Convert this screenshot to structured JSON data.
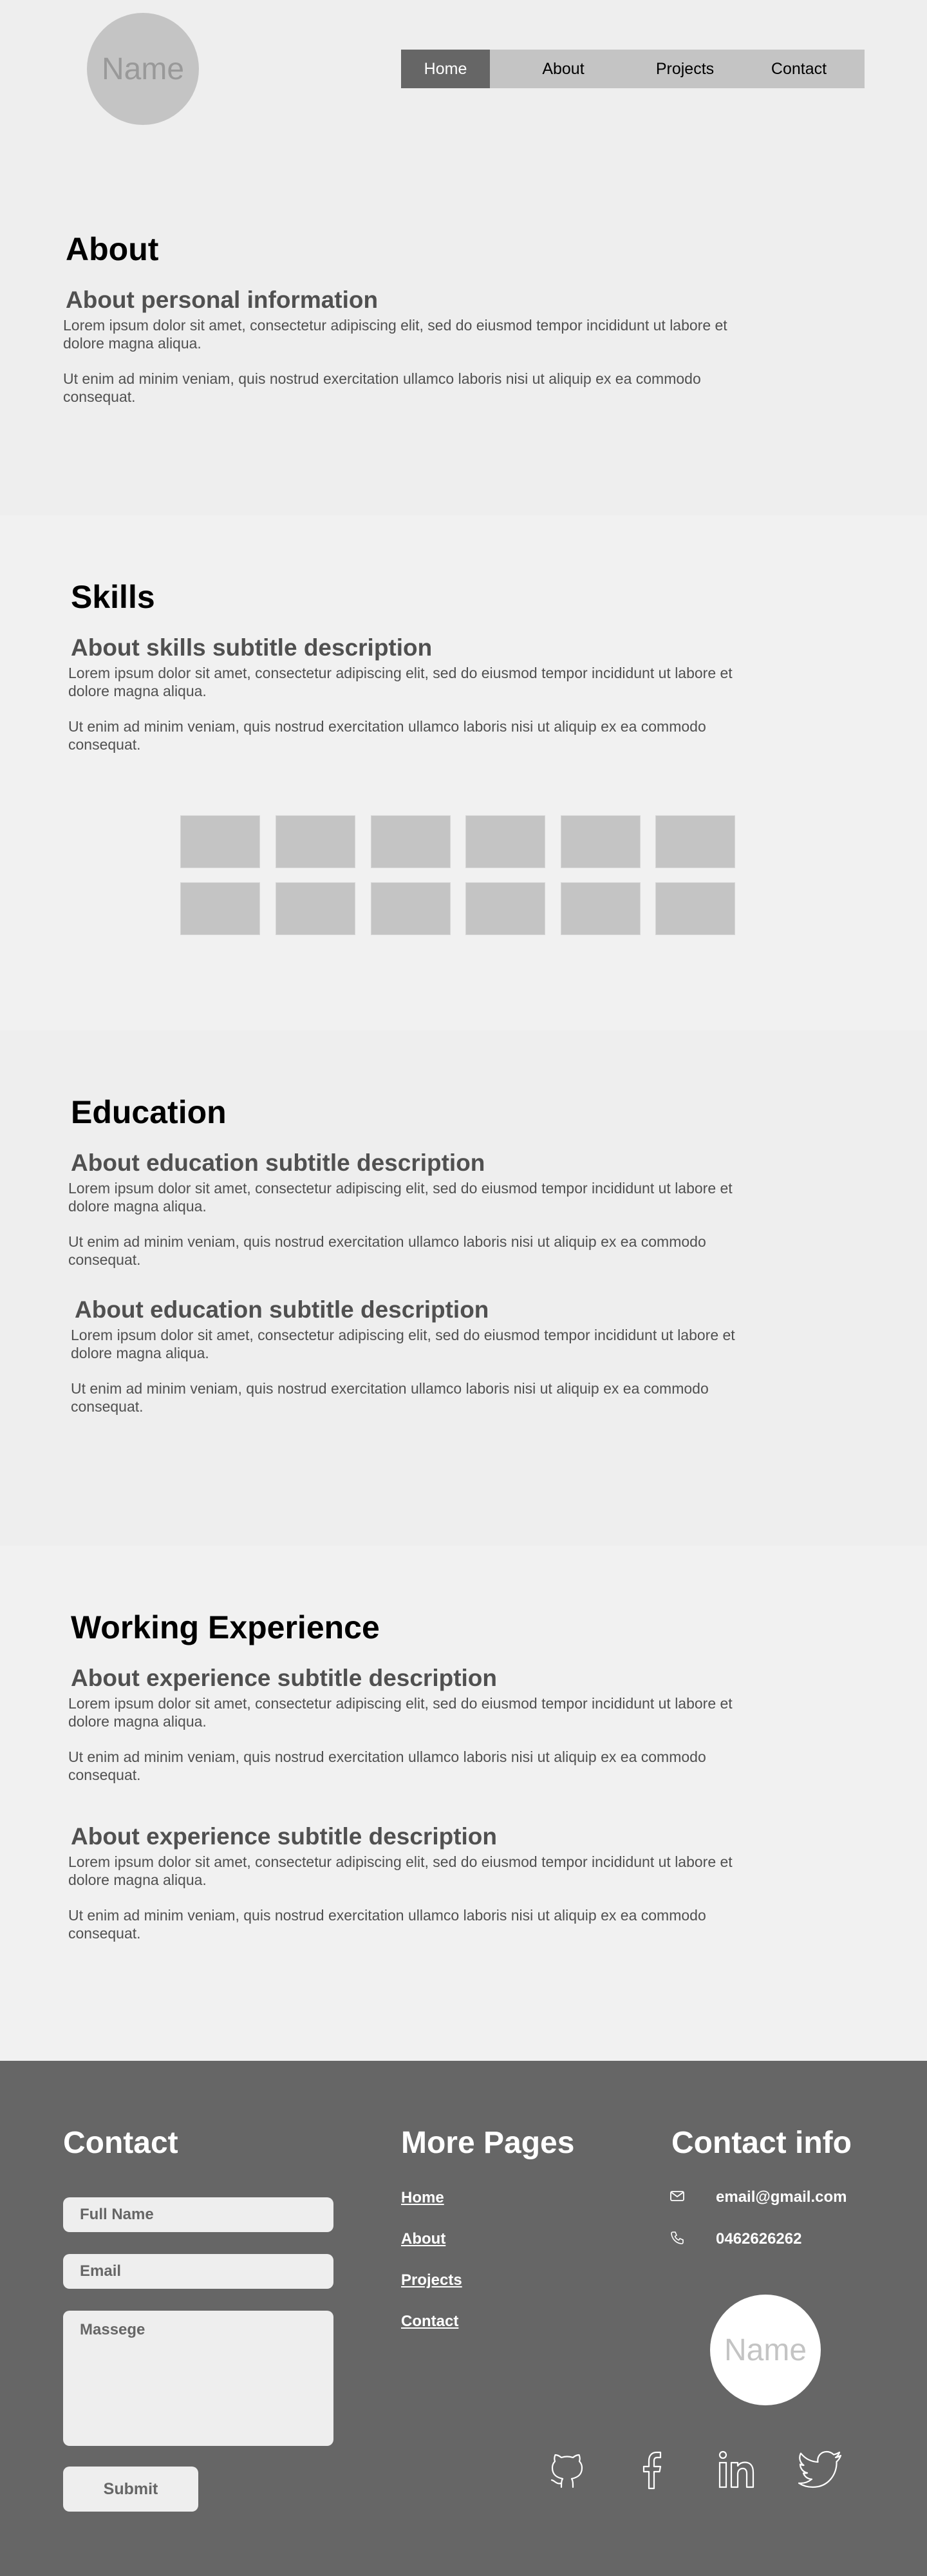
{
  "header": {
    "logo_text": "Name",
    "nav": [
      {
        "label": "Home",
        "active": true
      },
      {
        "label": "About",
        "active": false
      },
      {
        "label": "Projects",
        "active": false
      },
      {
        "label": "Contact",
        "active": false
      }
    ]
  },
  "about": {
    "title": "About",
    "subtitle": "About personal information",
    "paragraphs": [
      "Lorem ipsum dolor sit amet, consectetur adipiscing elit, sed do eiusmod tempor incididunt ut labore et dolore magna aliqua.",
      "Ut enim ad minim veniam, quis nostrud exercitation ullamco laboris nisi ut aliquip ex ea commodo consequat."
    ]
  },
  "skills": {
    "title": "Skills",
    "subtitle": "About skills subtitle description",
    "paragraphs": [
      "Lorem ipsum dolor sit amet, consectetur adipiscing elit, sed do eiusmod tempor incididunt ut labore et dolore magna aliqua.",
      "Ut enim ad minim veniam, quis nostrud exercitation ullamco laboris nisi ut aliquip ex ea commodo consequat."
    ],
    "box_color": "#C4C4C4"
  },
  "education": {
    "title": "Education",
    "items": [
      {
        "subtitle": "About education subtitle description",
        "paragraphs": [
          "Lorem ipsum dolor sit amet, consectetur adipiscing elit, sed do eiusmod tempor incididunt ut labore et dolore magna aliqua.",
          "Ut enim ad minim veniam, quis nostrud exercitation ullamco laboris nisi ut aliquip ex ea commodo consequat."
        ]
      },
      {
        "subtitle": "About education subtitle description",
        "paragraphs": [
          "Lorem ipsum dolor sit amet, consectetur adipiscing elit, sed do eiusmod tempor incididunt ut labore et dolore magna aliqua.",
          "Ut enim ad minim veniam, quis nostrud exercitation ullamco laboris nisi ut aliquip ex ea commodo consequat."
        ]
      }
    ]
  },
  "experience": {
    "title": "Working Experience",
    "items": [
      {
        "subtitle": "About experience subtitle description",
        "paragraphs": [
          "Lorem ipsum dolor sit amet, consectetur adipiscing elit, sed do eiusmod tempor incididunt ut labore et dolore magna aliqua.",
          "Ut enim ad minim veniam, quis nostrud exercitation ullamco laboris nisi ut aliquip ex ea commodo consequat."
        ]
      },
      {
        "subtitle": "About experience subtitle description",
        "paragraphs": [
          "Lorem ipsum dolor sit amet, consectetur adipiscing elit, sed do eiusmod tempor incididunt ut labore et dolore magna aliqua.",
          "Ut enim ad minim veniam, quis nostrud exercitation ullamco laboris nisi ut aliquip ex ea commodo consequat."
        ]
      }
    ]
  },
  "footer": {
    "contact": {
      "title": "Contact",
      "full_name_placeholder": "Full Name",
      "email_placeholder": "Email",
      "message_placeholder": "Massege",
      "submit_label": "Submit"
    },
    "more_pages": {
      "title": "More Pages",
      "links": [
        "Home",
        "About",
        "Projects",
        "Contact"
      ]
    },
    "contact_info": {
      "title": "Contact info",
      "email": "email@gmail.com",
      "phone": "0462626262",
      "logo_text": "Name"
    },
    "social_icons": [
      "github-icon",
      "facebook-icon",
      "linkedin-icon",
      "twitter-icon"
    ],
    "colors": {
      "footer_bg": "#666666",
      "accent": "#666666",
      "placeholder_gray": "#C4C4C4"
    }
  }
}
